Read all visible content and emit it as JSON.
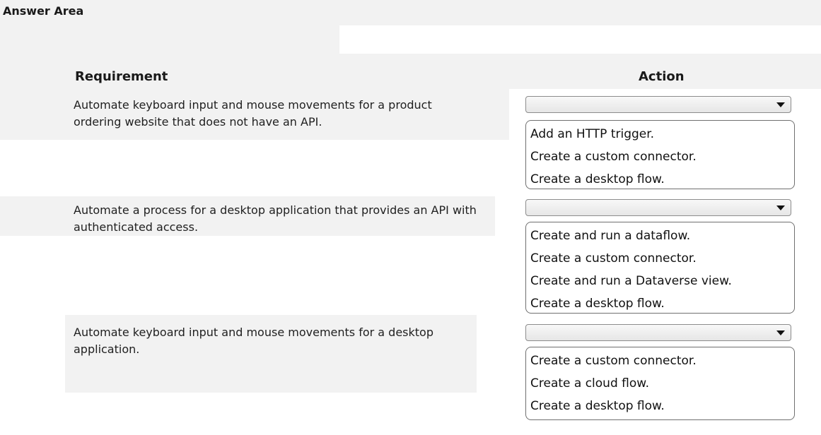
{
  "answer_area": {
    "title": "Answer Area"
  },
  "headers": {
    "requirement": "Requirement",
    "action": "Action"
  },
  "rows": [
    {
      "requirement": "Automate keyboard input and mouse movements for a product ordering website that does not have an API.",
      "selected": "",
      "options": [
        "Add an HTTP trigger.",
        "Create a custom connector.",
        "Create a desktop flow."
      ]
    },
    {
      "requirement": "Automate a process for a desktop application that provides an API with authenticated access.",
      "selected": "",
      "options": [
        "Create and run a dataflow.",
        "Create a custom connector.",
        "Create and run a Dataverse view.",
        "Create a desktop flow."
      ]
    },
    {
      "requirement": "Automate keyboard input and mouse movements for a desktop application.",
      "selected": "",
      "options": [
        "Create a custom connector.",
        "Create a cloud flow.",
        "Create a desktop flow."
      ]
    }
  ],
  "icons": {
    "dropdown": "chevron-down-icon"
  }
}
